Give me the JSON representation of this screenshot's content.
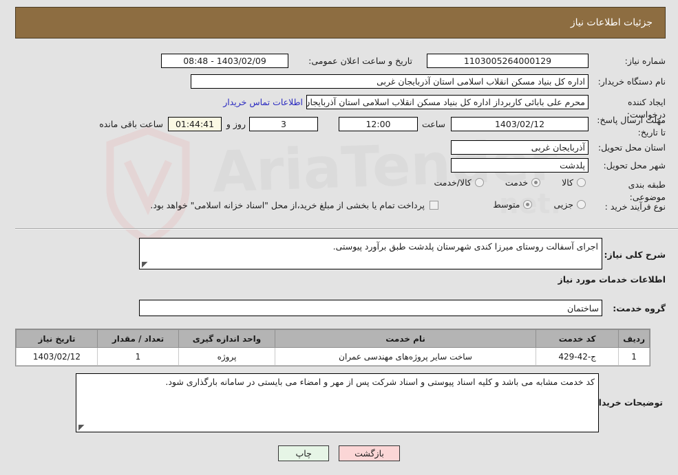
{
  "header": {
    "title": "جزئیات اطلاعات نیاز"
  },
  "info": {
    "need_number_label": "شماره نیاز:",
    "need_number_value": "1103005264000129",
    "public_announce_label": "تاریخ و ساعت اعلان عمومی:",
    "public_announce_value": "1403/02/09 - 08:48",
    "buyer_org_label": "نام دستگاه خریدار:",
    "buyer_org_value": "اداره کل بنیاد مسکن انقلاب اسلامی استان آذربایجان غربی",
    "creator_label": "ایجاد کننده درخواست:",
    "creator_value": "محرم علی بابائی کاربرداز اداره کل بنیاد مسکن انقلاب اسلامی استان آذربایجان",
    "contact_link": "اطلاعات تماس خریدار",
    "deadline_label": "مهلت ارسال پاسخ: تا تاریخ:",
    "deadline_date": "1403/02/12",
    "deadline_hour_label": "ساعت",
    "deadline_hour_value": "12:00",
    "remaining_days_value": "3",
    "remaining_days_label": "روز و",
    "remaining_time_value": "01:44:41",
    "remaining_suffix_label": "ساعت باقی مانده",
    "province_label": "استان محل تحویل:",
    "province_value": "آذربایجان غربی",
    "city_label": "شهر محل تحویل:",
    "city_value": "پلدشت",
    "category_label": "طبقه بندی موضوعی:",
    "category_options": [
      {
        "label": "کالا",
        "selected": false
      },
      {
        "label": "خدمت",
        "selected": true
      },
      {
        "label": "کالا/خدمت",
        "selected": false
      }
    ],
    "process_label": "نوع فرآیند خرید :",
    "process_options": [
      {
        "label": "جزیی",
        "selected": false
      },
      {
        "label": "متوسط",
        "selected": true
      }
    ],
    "treasury_checkbox_label": "پرداخت تمام یا بخشی از مبلغ خرید،از محل \"اسناد خزانه اسلامی\" خواهد بود.",
    "treasury_checked": false
  },
  "description": {
    "general_label": "شرح کلی نیاز:",
    "general_value": "اجرای آسفالت روستای میرزا کندی شهرستان پلدشت طبق برآورد پیوستی.",
    "services_heading": "اطلاعات خدمات مورد نیاز",
    "service_group_label": "گروه خدمت:",
    "service_group_value": "ساختمان"
  },
  "table": {
    "columns": [
      "ردیف",
      "کد خدمت",
      "نام خدمت",
      "واحد اندازه گیری",
      "تعداد / مقدار",
      "تاریخ نیاز"
    ],
    "rows": [
      {
        "radif": "1",
        "code": "ج-42-429",
        "name": "ساخت سایر پروژه‌های مهندسی عمران",
        "unit": "پروژه",
        "qty": "1",
        "date": "1403/02/12"
      }
    ]
  },
  "notes": {
    "label": "توضیحات خریدار:",
    "value": "کد خدمت مشابه می باشد و کلیه اسناد پیوستی و اسناد شرکت پس از مهر و امضاء می بایستی در سامانه بارگذاری شود."
  },
  "buttons": {
    "print": "چاپ",
    "back": "بازگشت"
  },
  "watermark": {
    "text": "AriaTender.net"
  }
}
